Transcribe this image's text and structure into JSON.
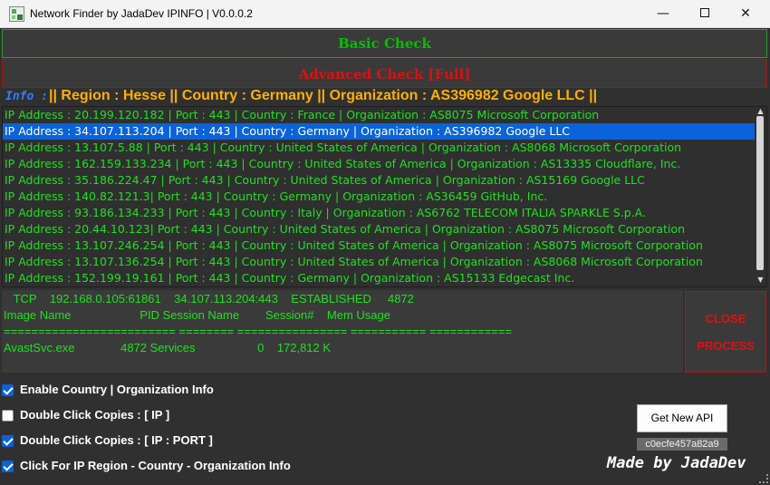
{
  "window": {
    "title": "Network Finder by JadaDev IPINFO | V0.0.0.2",
    "minimize": "—",
    "close": "✕"
  },
  "buttons": {
    "basic": "Basic Check",
    "advanced": "Advanced Check [Full]",
    "close_process_1": "CLOSE",
    "close_process_2": "PROCESS",
    "get_api": "Get New API"
  },
  "info": {
    "tag": "Info :",
    "text": "|| Region : Hesse || Country : Germany || Organization : AS396982 Google LLC ||"
  },
  "ip_list": {
    "selected_index": 1,
    "rows": [
      "IP Address : 20.199.120.182   | Port : 443  | Country : France  | Organization : AS8075 Microsoft Corporation",
      "IP Address : 34.107.113.204   | Port : 443  | Country : Germany | Organization : AS396982 Google LLC",
      "IP Address : 13.107.5.88 | Port : 443  | Country : United States of America | Organization : AS8068 Microsoft Corporation",
      "IP Address : 162.159.133.234   | Port : 443  | Country : United States of America | Organization : AS13335 Cloudflare, Inc.",
      "IP Address : 35.186.224.47  | Port : 443  | Country : United States of America | Organization : AS15169 Google LLC",
      "IP Address : 140.82.121.3| Port : 443  | Country : Germany  | Organization : AS36459 GitHub, Inc.",
      "IP Address : 93.186.134.233   | Port : 443  | Country : Italy | Organization : AS6762 TELECOM ITALIA SPARKLE S.p.A.",
      "IP Address : 20.44.10.123| Port : 443  | Country : United States of America | Organization : AS8075 Microsoft Corporation",
      "IP Address : 13.107.246.254   | Port : 443  | Country : United States of America | Organization : AS8075 Microsoft Corporation",
      "IP Address : 13.107.136.254   | Port : 443  | Country : United States of America | Organization : AS8068 Microsoft Corporation",
      "IP Address : 152.199.19.161   | Port : 443  | Country : Germany  | Organization : AS15133 Edgecast Inc."
    ]
  },
  "cmd_output": {
    "lines": [
      "   TCP    192.168.0.105:61861    34.107.113.204:443    ESTABLISHED     4872",
      "Image Name                     PID Session Name        Session#    Mem Usage",
      "========================= ======== ================ =========== ============",
      "AvastSvc.exe              4872 Services                   0    172,812 K"
    ]
  },
  "options": [
    {
      "label": "Enable Country | Organization Info",
      "checked": true
    },
    {
      "label": "Double Click Copies :  [ IP ]",
      "checked": false
    },
    {
      "label": "Double Click Copies :  [ IP : PORT ]",
      "checked": true
    },
    {
      "label": "Click For IP Region - Country - Organization Info",
      "checked": true
    }
  ],
  "api_key": "c0ecfe457a82a9",
  "footer": {
    "made_by": "Made by JadaDev"
  },
  "colors": {
    "background": "#303030",
    "list_text": "#20e020",
    "selected_row": "#0a63d8",
    "info_text": "#ffb000",
    "info_tag": "#2f7dff",
    "advanced_red": "#dd1010"
  }
}
